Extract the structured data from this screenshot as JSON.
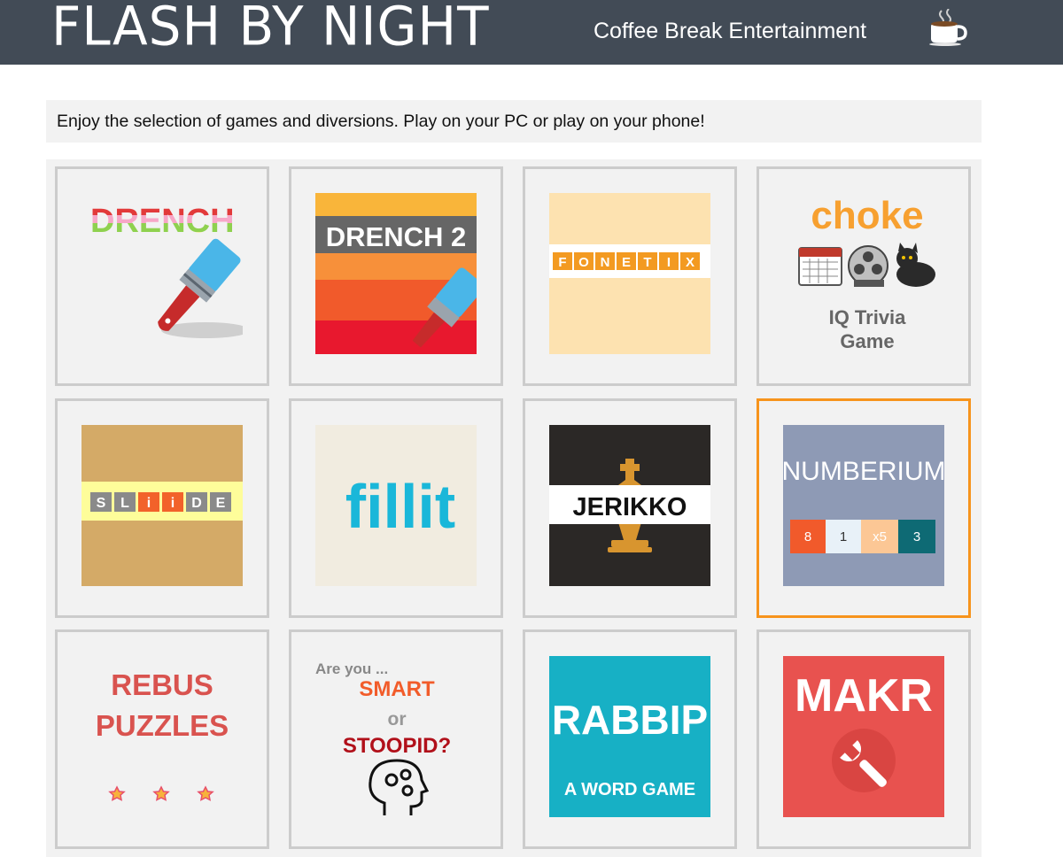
{
  "header": {
    "logo_text": "FLASH BY NIGHT",
    "tagline": "Coffee Break Entertainment",
    "cup_icon": "coffee-cup-icon"
  },
  "intro": {
    "text": "Enjoy the selection of games and diversions. Play on your PC or play on your phone!"
  },
  "games": [
    {
      "id": "drench",
      "title": "DRENCH"
    },
    {
      "id": "drench-2",
      "title": "DRENCH 2"
    },
    {
      "id": "fonetix",
      "title": "FONETIX",
      "letters": [
        "F",
        "O",
        "N",
        "E",
        "T",
        "I",
        "X"
      ]
    },
    {
      "id": "choke",
      "title": "choke",
      "subtitle_line1": "IQ Trivia",
      "subtitle_line2": "Game"
    },
    {
      "id": "sliide",
      "title": "SLIIDE",
      "letters": [
        "S",
        "L",
        "i",
        "i",
        "D",
        "E"
      ]
    },
    {
      "id": "fillit",
      "title": "fillit"
    },
    {
      "id": "jerikko",
      "title": "JERIKKO"
    },
    {
      "id": "numberium",
      "title": "NUMBERIUM",
      "cells": [
        "8",
        "1",
        "x5",
        "3"
      ],
      "selected": true
    },
    {
      "id": "rebus-puzzles",
      "title_line1": "REBUS",
      "title_line2": "PUZZLES"
    },
    {
      "id": "smart-or-stoopid",
      "line1": "Are you ...",
      "line2": "SMART",
      "line3": "or",
      "line4": "STOOPID?"
    },
    {
      "id": "rabbip",
      "title": "RABBIP",
      "subtitle": "A WORD GAME"
    },
    {
      "id": "makr",
      "title": "MAKR"
    }
  ],
  "colors": {
    "header_bg": "#424b56",
    "selected_border": "#f7941d",
    "tile_border": "#cccccc"
  }
}
